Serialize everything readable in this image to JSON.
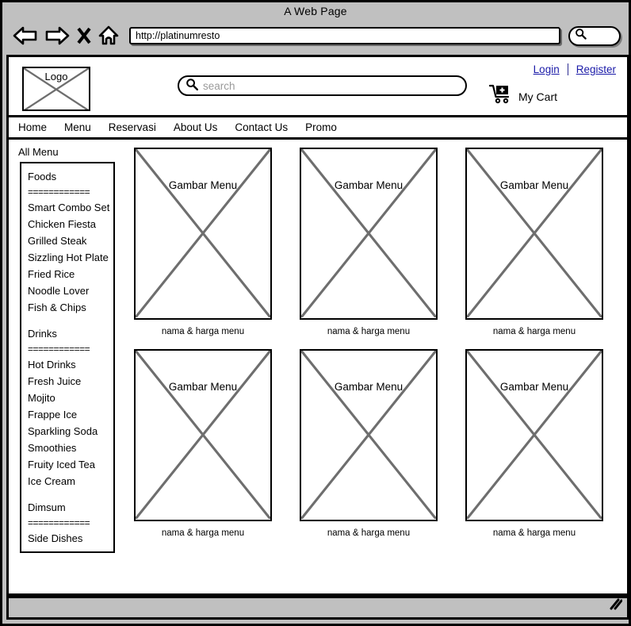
{
  "window": {
    "title": "A Web Page"
  },
  "browser": {
    "nav_icons": [
      "back-arrow-icon",
      "forward-arrow-icon",
      "close-x-icon",
      "home-icon"
    ],
    "url_value": "http://platinumresto",
    "chrome_search_icon": "magnifier-icon"
  },
  "header": {
    "logo_label": "Logo",
    "search": {
      "icon": "magnifier-icon",
      "placeholder": "search",
      "value": ""
    },
    "login_label": "Login",
    "register_label": "Register",
    "cart_label": "My Cart",
    "cart_icon": "shopping-cart-plus-icon"
  },
  "nav": {
    "items": [
      {
        "label": "Home"
      },
      {
        "label": "Menu"
      },
      {
        "label": "Reservasi"
      },
      {
        "label": "About Us"
      },
      {
        "label": "Contact Us"
      },
      {
        "label": "Promo"
      }
    ]
  },
  "sidebar": {
    "title": "All Menu",
    "items": [
      {
        "label": "Foods",
        "kind": "heading"
      },
      {
        "label": "============",
        "kind": "rule"
      },
      {
        "label": "Smart Combo Set",
        "kind": "item"
      },
      {
        "label": "Chicken Fiesta",
        "kind": "item"
      },
      {
        "label": "Grilled Steak",
        "kind": "item"
      },
      {
        "label": "Sizzling Hot Plate",
        "kind": "item"
      },
      {
        "label": "Fried Rice",
        "kind": "item"
      },
      {
        "label": "Noodle Lover",
        "kind": "item"
      },
      {
        "label": "Fish & Chips",
        "kind": "item"
      },
      {
        "label": "",
        "kind": "spacer"
      },
      {
        "label": "Drinks",
        "kind": "heading"
      },
      {
        "label": "============",
        "kind": "rule"
      },
      {
        "label": "Hot Drinks",
        "kind": "item"
      },
      {
        "label": "Fresh Juice",
        "kind": "item"
      },
      {
        "label": "Mojito",
        "kind": "item"
      },
      {
        "label": "Frappe Ice",
        "kind": "item"
      },
      {
        "label": "Sparkling Soda",
        "kind": "item"
      },
      {
        "label": "Smoothies",
        "kind": "item"
      },
      {
        "label": "Fruity Iced Tea",
        "kind": "item"
      },
      {
        "label": "Ice Cream",
        "kind": "item"
      },
      {
        "label": "",
        "kind": "spacer"
      },
      {
        "label": "Dimsum",
        "kind": "heading"
      },
      {
        "label": "============",
        "kind": "rule"
      },
      {
        "label": "Side Dishes",
        "kind": "item"
      }
    ]
  },
  "main": {
    "rows": [
      {
        "cards": [
          {
            "image_label": "Gambar Menu",
            "caption": "nama & harga menu"
          },
          {
            "image_label": "Gambar Menu",
            "caption": "nama & harga menu"
          },
          {
            "image_label": "Gambar Menu",
            "caption": "nama & harga menu"
          }
        ]
      },
      {
        "cards": [
          {
            "image_label": "Gambar Menu",
            "caption": "nama & harga menu"
          },
          {
            "image_label": "Gambar Menu",
            "caption": "nama & harga menu"
          },
          {
            "image_label": "Gambar Menu",
            "caption": "nama & harga menu"
          }
        ]
      }
    ]
  },
  "statusbar": {
    "resize_icon": "resize-grip-icon"
  },
  "colors": {
    "chrome_gray": "#c0c0c0",
    "link_blue": "#1a1aa8",
    "placeholder_gray": "#9a9a9a",
    "cross_gray": "#6e6e6e",
    "outline_black": "#000000"
  }
}
